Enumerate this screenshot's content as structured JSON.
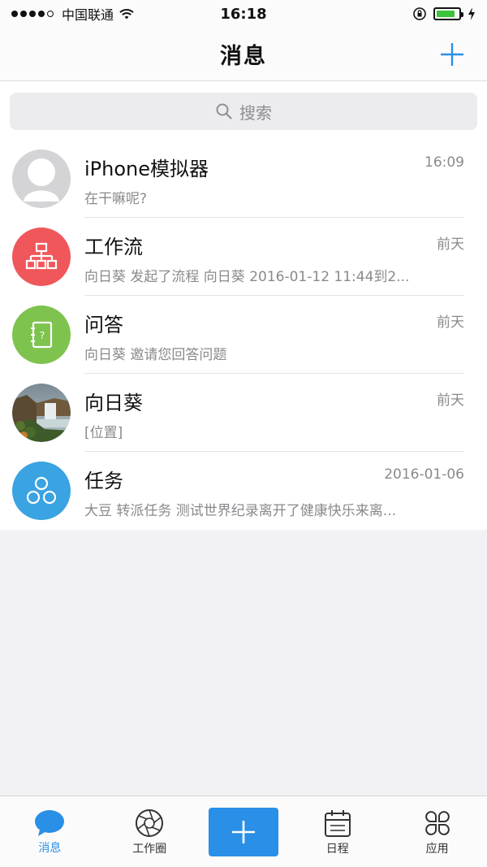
{
  "status_bar": {
    "carrier": "中国联通",
    "time": "16:18"
  },
  "header": {
    "title": "消息",
    "add_icon": "plus-icon"
  },
  "search": {
    "placeholder": "搜索",
    "icon": "search-icon"
  },
  "messages": [
    {
      "title": "iPhone模拟器",
      "time": "16:09",
      "subtitle": "在干嘛呢?",
      "avatar": "default-person-avatar"
    },
    {
      "title": "工作流",
      "time": "前天",
      "subtitle": "向日葵 发起了流程 向日葵 2016-01-12 11:44到2...",
      "avatar": "workflow-icon",
      "color": "#f0575b"
    },
    {
      "title": "问答",
      "time": "前天",
      "subtitle": "向日葵 邀请您回答问题",
      "avatar": "qa-notebook-icon",
      "color": "#7ec34e"
    },
    {
      "title": "向日葵",
      "time": "前天",
      "subtitle": "[位置]",
      "avatar": "waterfall-photo-avatar"
    },
    {
      "title": "任务",
      "time": "2016-01-06",
      "subtitle": "大豆 转派任务 测试世界纪录离开了健康快乐来离...",
      "avatar": "task-circles-icon",
      "color": "#3aa3e2"
    }
  ],
  "tab_bar": {
    "tabs": [
      {
        "label": "消息",
        "icon": "chat-bubble-icon",
        "active": true
      },
      {
        "label": "工作圈",
        "icon": "aperture-icon"
      },
      {
        "label": "",
        "icon": "plus-icon"
      },
      {
        "label": "日程",
        "icon": "calendar-icon"
      },
      {
        "label": "应用",
        "icon": "clover-grid-icon"
      }
    ]
  },
  "colors": {
    "accent": "#2a8fe6",
    "battery": "#3bc43b"
  }
}
